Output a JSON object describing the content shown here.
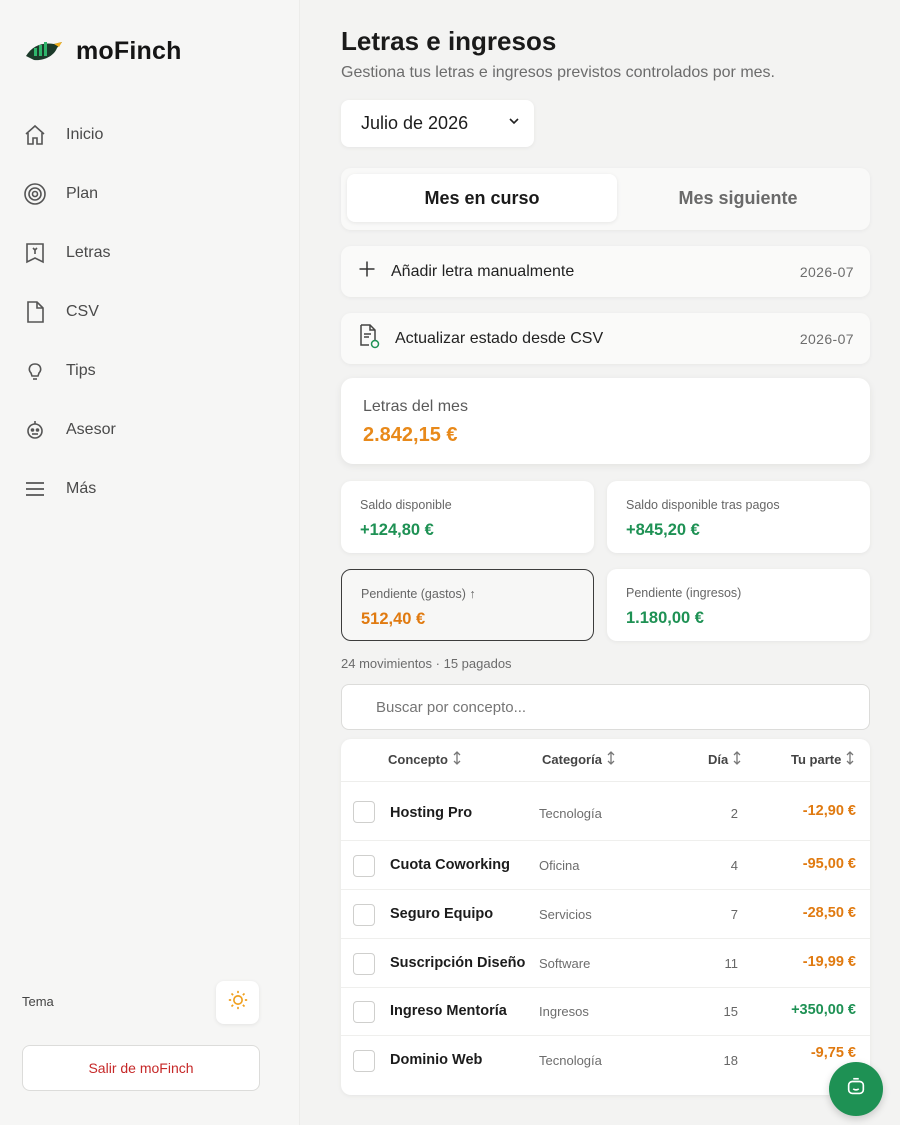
{
  "brand": {
    "name": "moFinch",
    "logo_icon": "finch-logo"
  },
  "sidebar": {
    "items": [
      {
        "label": "Inicio",
        "icon": "home-icon"
      },
      {
        "label": "Plan",
        "icon": "target-icon"
      },
      {
        "label": "Letras",
        "icon": "receipt-icon"
      },
      {
        "label": "CSV",
        "icon": "file-icon"
      },
      {
        "label": "Tips",
        "icon": "lightbulb-icon"
      },
      {
        "label": "Asesor",
        "icon": "advisor-icon"
      },
      {
        "label": "Más",
        "icon": "menu-icon"
      }
    ],
    "theme_label": "Tema",
    "theme_icon": "sun-icon",
    "logout_label": "Salir de moFinch"
  },
  "header": {
    "title": "Letras e ingresos",
    "subtitle": "Gestiona tus letras e ingresos previstos controlados por mes.",
    "month_selected": "Julio de 2026"
  },
  "tabs": [
    {
      "label": "Mes en curso",
      "active": true
    },
    {
      "label": "Mes siguiente",
      "active": false
    }
  ],
  "actions": [
    {
      "label": "Añadir letra manualmente",
      "month": "2026-07",
      "icon": "plus-icon"
    },
    {
      "label": "Actualizar estado desde CSV",
      "month": "2026-07",
      "icon": "csv-refresh-icon"
    }
  ],
  "letras_mes": {
    "label": "Letras del mes",
    "value": "2.842,15 €"
  },
  "stats": [
    {
      "label": "Saldo disponible",
      "value": "+124,80 €",
      "tone": "green"
    },
    {
      "label": "Saldo disponible tras pagos",
      "value": "+845,20 €",
      "tone": "green"
    },
    {
      "label": "Pendiente (gastos) ↑",
      "value": "512,40 €",
      "tone": "orange"
    },
    {
      "label": "Pendiente (ingresos)",
      "value": "1.180,00 €",
      "tone": "green"
    }
  ],
  "summary": "24 movimientos · 15 pagados",
  "search": {
    "placeholder": "Buscar por concepto..."
  },
  "table": {
    "headers": {
      "concept": "Concepto",
      "category": "Categoría",
      "day": "Día",
      "share": "Tu parte"
    },
    "rows": [
      {
        "concept": "Hosting Pro",
        "category": "Tecnología",
        "day": "2",
        "amount": "-12,90 €",
        "tone": "orange"
      },
      {
        "concept": "Cuota Coworking",
        "category": "Oficina",
        "day": "4",
        "amount": "-95,00 €",
        "tone": "orange"
      },
      {
        "concept": "Seguro Equipo",
        "category": "Servicios",
        "day": "7",
        "amount": "-28,50 €",
        "tone": "orange"
      },
      {
        "concept": "Suscripción Diseño",
        "category": "Software",
        "day": "11",
        "amount": "-19,99 €",
        "tone": "orange"
      },
      {
        "concept": "Ingreso Mentoría",
        "category": "Ingresos",
        "day": "15",
        "amount": "+350,00 €",
        "tone": "green"
      },
      {
        "concept": "Dominio Web",
        "category": "Tecnología",
        "day": "18",
        "amount": "-9,75 €",
        "tone": "orange"
      }
    ]
  },
  "colors": {
    "accent_green": "#1e9154",
    "accent_orange": "#e07a10",
    "logout_red": "#c62828"
  },
  "fab": {
    "icon": "chat-bot-icon"
  }
}
